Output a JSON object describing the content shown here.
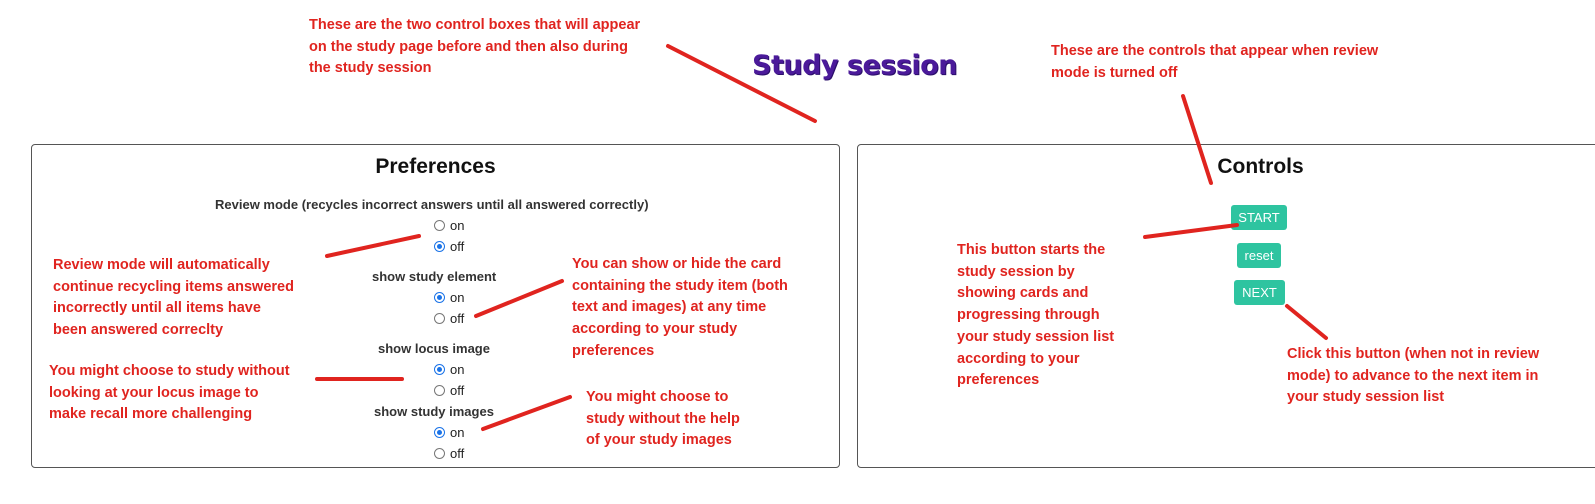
{
  "page": {
    "title": "Study session"
  },
  "preferences": {
    "title": "Preferences",
    "options": [
      {
        "label": "Review mode (recycles incorrect answers until all answered correctly)",
        "choices": [
          "on",
          "off"
        ],
        "selected": "off"
      },
      {
        "label": "show study element",
        "choices": [
          "on",
          "off"
        ],
        "selected": "on"
      },
      {
        "label": "show locus image",
        "choices": [
          "on",
          "off"
        ],
        "selected": "on"
      },
      {
        "label": "show study images",
        "choices": [
          "on",
          "off"
        ],
        "selected": "on"
      }
    ]
  },
  "controls": {
    "title": "Controls",
    "buttons": [
      "START",
      "reset",
      "NEXT"
    ]
  },
  "annotations": {
    "control_boxes": [
      "These are the two control boxes that will appear",
      "on the study page before and then also during",
      "the study session"
    ],
    "review_off_controls": [
      "These are the controls that appear when review",
      "mode is turned off"
    ],
    "review_mode": [
      "Review mode will automatically",
      "continue recycling items answered",
      "incorrectly  until all items have",
      "been answered correclty"
    ],
    "show_card": [
      "You can show or hide the card",
      "containing the study item (both",
      "text and images) at any time",
      "according to your study",
      "preferences"
    ],
    "locus": [
      "You might choose to study without",
      "looking at your locus image to",
      "make recall more challenging"
    ],
    "study_images": [
      "You might choose to",
      "study without the help",
      "of your study images"
    ],
    "start_button": [
      "This button starts the",
      "study session by",
      "showing cards and",
      "progressing through",
      "your study session list",
      "according to your",
      "preferences"
    ],
    "next_button": [
      "Click this button (when not in review",
      "mode) to advance to the next item in",
      "your study session list"
    ]
  },
  "colors": {
    "annotation": "#e0241f",
    "button": "#2ec4a0",
    "title": "#4b1a9a",
    "radio": "#1a73e8"
  }
}
